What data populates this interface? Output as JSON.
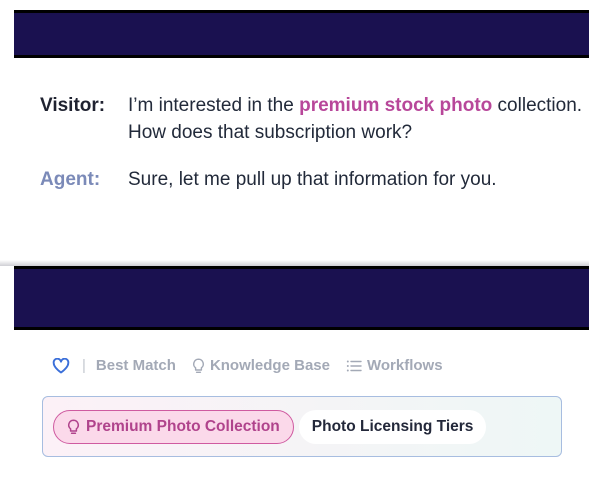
{
  "transcript": {
    "visitor": {
      "speaker": "Visitor:",
      "prefix": "I’m interested in the ",
      "highlight": "premium stock photo",
      "suffix": " collection. How does that subscription work?"
    },
    "agent": {
      "speaker": "Agent:",
      "message": "Sure, let me pull up that information for you."
    }
  },
  "tabs": {
    "favorite_icon": "heart-icon",
    "separator": "|",
    "items": [
      {
        "label": "Best Match",
        "icon": ""
      },
      {
        "label": "Knowledge Base",
        "icon": "lightbulb-icon"
      },
      {
        "label": "Workflows",
        "icon": "list-icon"
      }
    ]
  },
  "suggestions": [
    {
      "label": "Premium Photo Collection",
      "icon": "lightbulb-icon",
      "active": true
    },
    {
      "label": "Photo Licensing Tiers",
      "active": false
    }
  ],
  "colors": {
    "band": "#1a1150",
    "highlight": "#b8479a",
    "agent": "#7b8ab8",
    "chip_border": "#cf5aa0"
  }
}
